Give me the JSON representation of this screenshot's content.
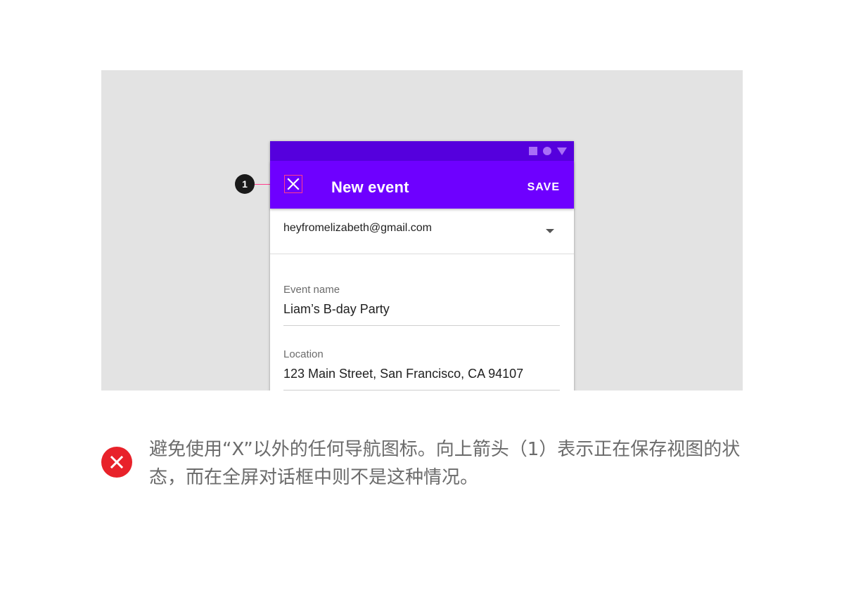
{
  "app_bar": {
    "title": "New event",
    "save_label": "SAVE",
    "background_color": "#6e00ff",
    "status_bar_color": "#5500dd"
  },
  "account": {
    "email": "heyfromelizabeth@gmail.com"
  },
  "fields": {
    "event_name": {
      "label": "Event name",
      "value": "Liam’s B-day Party"
    },
    "location": {
      "label": "Location",
      "value": "123 Main Street, San Francisco, CA 94107"
    }
  },
  "annotation": {
    "number": "1",
    "color": "#ff3d8b"
  },
  "caption": {
    "text": "避免使用“X”以外的任何导航图标。向上箭头（1）表示正在保存视图的状态，而在全屏对话框中则不是这种情况。",
    "icon_color": "#e8222a"
  },
  "icons": {
    "close": "close-icon",
    "dropdown": "chevron-down-icon",
    "error": "error-icon"
  }
}
